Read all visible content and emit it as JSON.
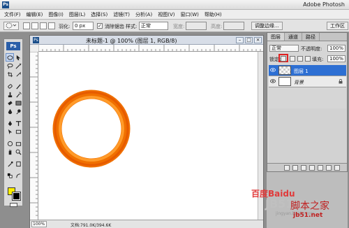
{
  "app": {
    "title": "Adobe Photosh",
    "logo": "Ps"
  },
  "menu": [
    "文件(F)",
    "编辑(E)",
    "图像(I)",
    "图层(L)",
    "选择(S)",
    "滤镜(T)",
    "分析(A)",
    "视图(V)",
    "窗口(W)",
    "帮助(H)"
  ],
  "options": {
    "feather_label": "羽化:",
    "feather_value": "0 px",
    "antialias_label": "消除锯齿",
    "antialias_checked": true,
    "style_label": "样式:",
    "style_value": "正常",
    "width_label": "宽度:",
    "height_label": "高度:",
    "refine_label": "调整边缘...",
    "workspace_label": "工作区"
  },
  "toolbox": {
    "badge": "Ps",
    "fg_color": "#ffee00",
    "bg_color": "#000000"
  },
  "document": {
    "title": "未标题-1 @ 100% (图层 1, RGB/8)",
    "zoom": "100%",
    "info": "文档:791.0K/394.6K",
    "ring_color_outer": "#f06a00",
    "ring_color_inner": "#ffab3d"
  },
  "layers_panel": {
    "tabs": [
      "图层",
      "通道",
      "路径"
    ],
    "blend_mode": "正常",
    "opacity_label": "不透明度:",
    "opacity_value": "100%",
    "lock_label": "锁定:",
    "fill_label": "填充:",
    "fill_value": "100%",
    "layers": [
      {
        "name": "图层 1",
        "active": true
      },
      {
        "name": "背景",
        "active": false
      }
    ]
  },
  "watermark": {
    "baidu": "百度Baidu",
    "jb": "JB51.Net",
    "site": "jb51.net",
    "jingyan": "jingyan.baidu.com",
    "script": "脚本之家"
  }
}
